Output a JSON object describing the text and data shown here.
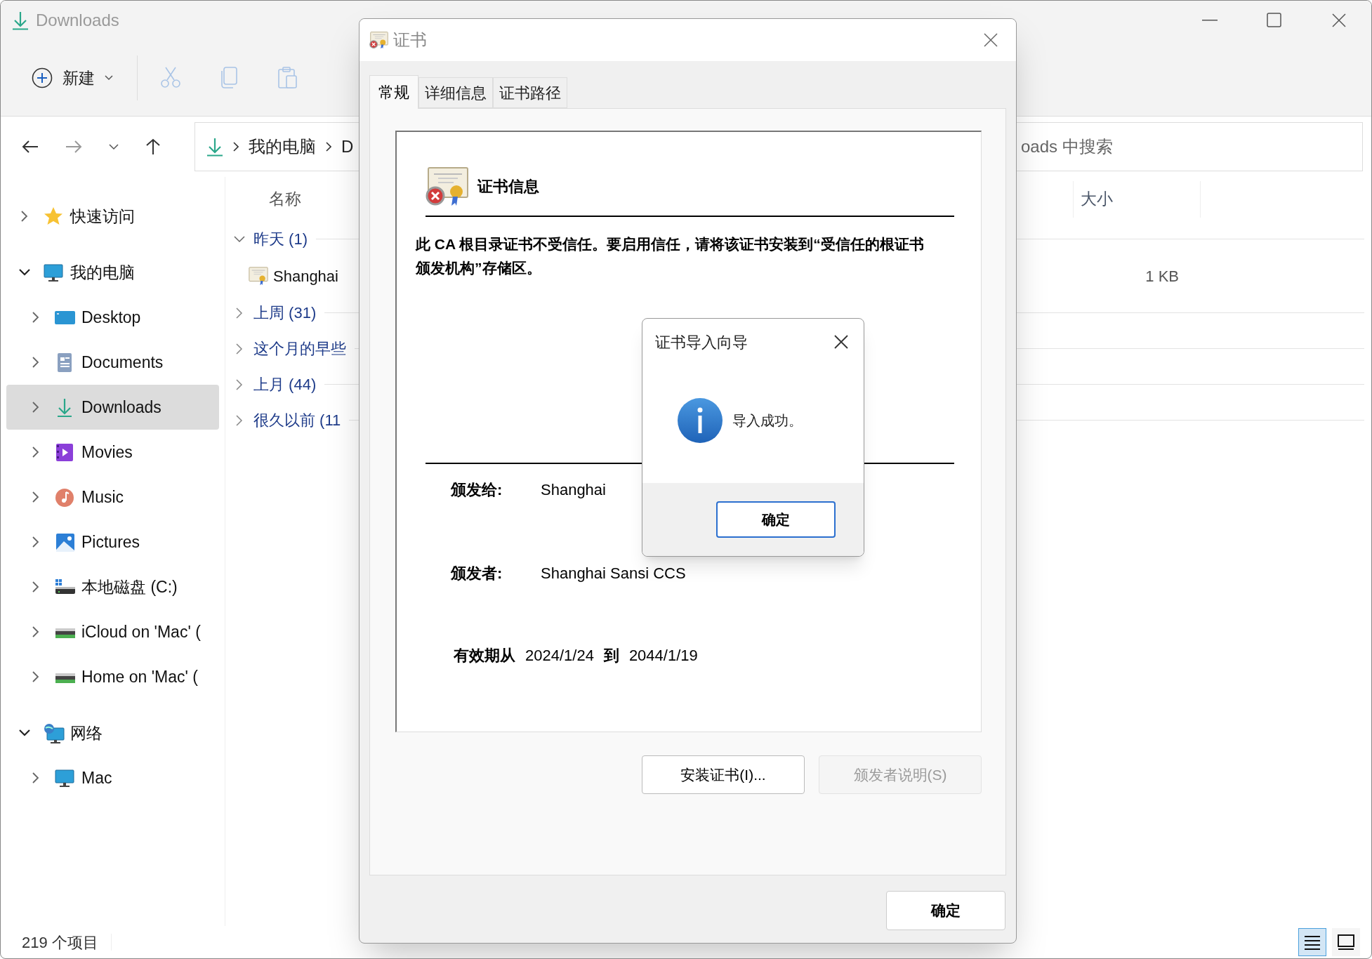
{
  "explorer": {
    "title": "Downloads",
    "toolbar": {
      "new_label": "新建",
      "actions": [
        {
          "kind": "cut",
          "disabled": true
        },
        {
          "kind": "copy",
          "disabled": true
        },
        {
          "kind": "paste",
          "disabled": true
        }
      ]
    },
    "breadcrumb": [
      "我的电脑",
      "D"
    ],
    "search": {
      "placeholder": "oads 中搜索"
    },
    "nav": [
      {
        "label": "快速访问",
        "kind": "star",
        "expanded": false,
        "selected": false
      },
      {
        "label": "我的电脑",
        "kind": "computer",
        "expanded": true,
        "selected": false,
        "children": [
          {
            "label": "Desktop",
            "kind": "desktop",
            "expanded": false,
            "selected": false
          },
          {
            "label": "Documents",
            "kind": "documents",
            "expanded": false,
            "selected": false
          },
          {
            "label": "Downloads",
            "kind": "download",
            "expanded": false,
            "selected": true
          },
          {
            "label": "Movies",
            "kind": "movies",
            "expanded": false,
            "selected": false
          },
          {
            "label": "Music",
            "kind": "music",
            "expanded": false,
            "selected": false
          },
          {
            "label": "Pictures",
            "kind": "pictures",
            "expanded": false,
            "selected": false
          },
          {
            "label": "本地磁盘 (C:)",
            "kind": "system-drive",
            "expanded": false,
            "selected": false
          },
          {
            "label": "iCloud on 'Mac' (",
            "kind": "network-drive",
            "expanded": false,
            "selected": false
          },
          {
            "label": "Home on 'Mac' (",
            "kind": "network-drive",
            "expanded": false,
            "selected": false
          }
        ]
      },
      {
        "label": "网络",
        "kind": "network",
        "expanded": true,
        "selected": false,
        "children": [
          {
            "label": "Mac",
            "kind": "computer",
            "expanded": false,
            "selected": false
          }
        ]
      }
    ],
    "columns": [
      {
        "label": "名称"
      },
      {
        "label": "大小"
      }
    ],
    "groups": [
      {
        "label": "昨天 (1)",
        "expanded": true,
        "files": [
          {
            "name": "Shanghai",
            "size": "1 KB"
          }
        ]
      },
      {
        "label": "上周 (31)",
        "expanded": false
      },
      {
        "label": "这个月的早些",
        "expanded": false
      },
      {
        "label": "上月 (44)",
        "expanded": false
      },
      {
        "label": "很久以前 (11",
        "expanded": false
      }
    ],
    "status_bar": {
      "count": "219 个项目",
      "views": [
        {
          "kind": "details",
          "selected": true
        },
        {
          "kind": "tiles",
          "selected": false
        }
      ]
    }
  },
  "cert_dialog": {
    "title": "证书",
    "tabs": [
      {
        "label": "常规",
        "selected": true
      },
      {
        "label": "详细信息",
        "selected": false
      },
      {
        "label": "证书路径",
        "selected": false
      }
    ],
    "heading": "证书信息",
    "message": "此 CA 根目录证书不受信任。要启用信任，请将该证书安装到“受信任的根证书颁发机构”存储区。",
    "fields": [
      {
        "label": "颁发给:",
        "value": "Shanghai"
      },
      {
        "label": "颁发者:",
        "value": "Shanghai Sansi CCS"
      }
    ],
    "validity": {
      "label": "有效期从",
      "from": "2024/1/24",
      "to_label": "到",
      "to": "2044/1/19"
    },
    "buttons": [
      {
        "label": "安装证书(I)...",
        "disabled": false
      },
      {
        "label": "颁发者说明(S)",
        "disabled": true
      }
    ],
    "ok": "确定"
  },
  "message_box": {
    "title": "证书导入向导",
    "message": "导入成功。",
    "ok": "确定"
  }
}
